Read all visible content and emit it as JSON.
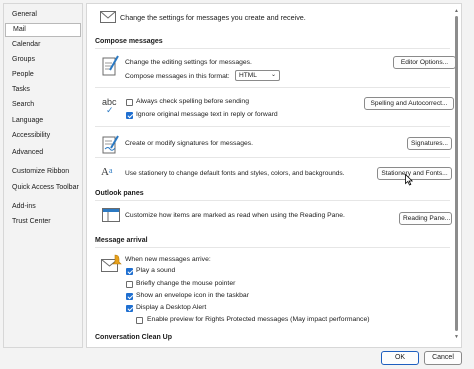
{
  "sidebar": {
    "items": [
      {
        "label": "General"
      },
      {
        "label": "Mail",
        "selected": true
      },
      {
        "label": "Calendar"
      },
      {
        "label": "Groups"
      },
      {
        "label": "People"
      },
      {
        "label": "Tasks"
      },
      {
        "label": "Search"
      },
      {
        "label": "Language"
      },
      {
        "label": "Accessibility"
      },
      {
        "label": "Advanced"
      },
      {
        "label": "Customize Ribbon"
      },
      {
        "label": "Quick Access Toolbar"
      },
      {
        "label": "Add-ins"
      },
      {
        "label": "Trust Center"
      }
    ]
  },
  "main": {
    "header": "Change the settings for messages you create and receive.",
    "compose": {
      "title": "Compose messages",
      "editing_text": "Change the editing settings for messages.",
      "editor_button": "Editor Options...",
      "format_label": "Compose messages in this format:",
      "format_value": "HTML",
      "spell_check": "Always check spelling before sending",
      "ignore_original": "Ignore original message text in reply or forward",
      "spelling_button": "Spelling and Autocorrect...",
      "signatures_text": "Create or modify signatures for messages.",
      "signatures_button": "Signatures...",
      "stationery_text": "Use stationery to change default fonts and styles, colors, and backgrounds.",
      "stationery_button": "Stationery and Fonts..."
    },
    "panes": {
      "title": "Outlook panes",
      "reading_text": "Customize how items are marked as read when using the Reading Pane.",
      "reading_button": "Reading Pane..."
    },
    "arrival": {
      "title": "Message arrival",
      "when_new": "When new messages arrive:",
      "play_sound": "Play a sound",
      "change_pointer": "Briefly change the mouse pointer",
      "envelope_icon": "Show an envelope icon in the taskbar",
      "desktop_alert": "Display a Desktop Alert",
      "rights_protected": "Enable preview for Rights Protected messages (May impact performance)"
    },
    "cleanup": {
      "title": "Conversation Clean Up"
    }
  },
  "checkbox_states": {
    "spell_check": false,
    "ignore_original": true,
    "play_sound": true,
    "change_pointer": false,
    "envelope_icon": true,
    "desktop_alert": true,
    "rights_protected": false
  },
  "footer": {
    "ok": "OK",
    "cancel": "Cancel"
  },
  "colors": {
    "accent": "#1f6fd0",
    "icon_blue": "#2b79c2"
  }
}
